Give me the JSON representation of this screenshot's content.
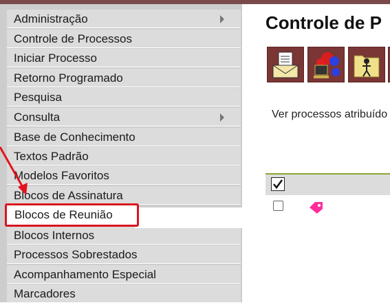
{
  "sidebar": {
    "items": [
      {
        "label": "Administração",
        "has_submenu": true
      },
      {
        "label": "Controle de Processos",
        "has_submenu": false
      },
      {
        "label": "Iniciar Processo",
        "has_submenu": false
      },
      {
        "label": "Retorno Programado",
        "has_submenu": false
      },
      {
        "label": "Pesquisa",
        "has_submenu": false
      },
      {
        "label": "Consulta",
        "has_submenu": true
      },
      {
        "label": "Base de Conhecimento",
        "has_submenu": false
      },
      {
        "label": "Textos Padrão",
        "has_submenu": false
      },
      {
        "label": "Modelos Favoritos",
        "has_submenu": false
      },
      {
        "label": "Blocos de Assinatura",
        "has_submenu": false
      },
      {
        "label": "Blocos de Reunião",
        "has_submenu": false,
        "highlighted": true
      },
      {
        "label": "Blocos Internos",
        "has_submenu": false
      },
      {
        "label": "Processos Sobrestados",
        "has_submenu": false
      },
      {
        "label": "Acompanhamento Especial",
        "has_submenu": false
      },
      {
        "label": "Marcadores",
        "has_submenu": false
      }
    ]
  },
  "main": {
    "title": "Controle de P",
    "toolbar": [
      "envelope-document-icon",
      "network-computer-icon",
      "folder-person-icon"
    ],
    "info_text": "Ver processos atribuído"
  },
  "colors": {
    "highlight_border": "#d9141c",
    "annotation_arrow": "#e0141c",
    "tag": "#ff2e9a",
    "table_accent": "#8aa838",
    "toolbar_bg": "#7a3535"
  }
}
